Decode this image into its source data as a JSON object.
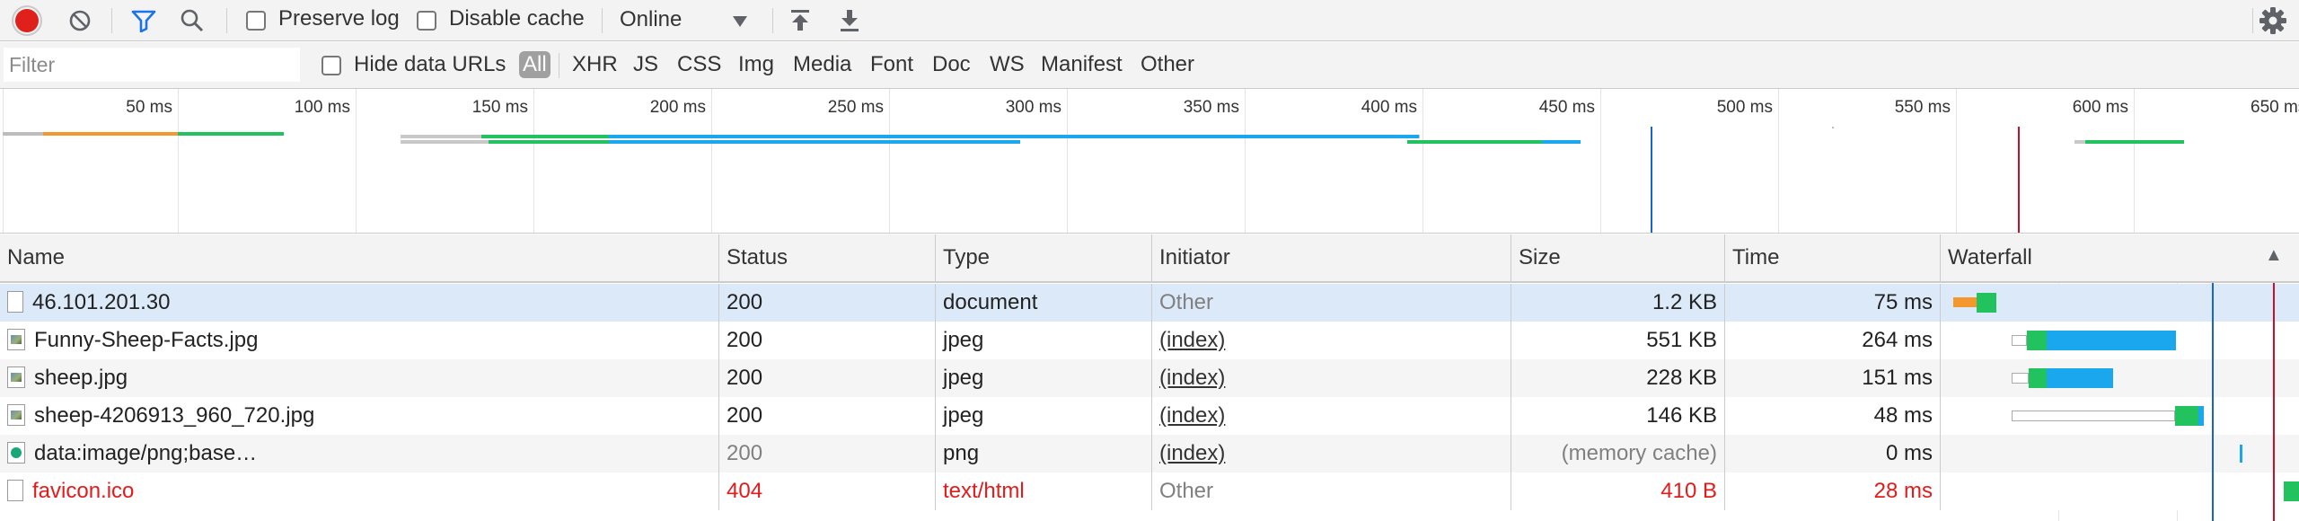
{
  "toolbar": {
    "record_icon": "record-icon",
    "clear_icon": "clear-icon",
    "filter_icon": "filter-icon",
    "search_icon": "search-icon",
    "preserve_log_label": "Preserve log",
    "disable_cache_label": "Disable cache",
    "throttling_value": "Online",
    "import_icon": "upload-icon",
    "export_icon": "download-icon",
    "settings_icon": "gear-icon"
  },
  "filterbar": {
    "filter_placeholder": "Filter",
    "hide_data_urls_label": "Hide data URLs",
    "types": [
      "All",
      "XHR",
      "JS",
      "CSS",
      "Img",
      "Media",
      "Font",
      "Doc",
      "WS",
      "Manifest",
      "Other"
    ],
    "active_type": "All"
  },
  "overview": {
    "ticks": [
      "50 ms",
      "100 ms",
      "150 ms",
      "200 ms",
      "250 ms",
      "300 ms",
      "350 ms",
      "400 ms",
      "450 ms",
      "500 ms",
      "550 ms",
      "600 ms",
      "650 ms"
    ]
  },
  "table": {
    "columns": [
      "Name",
      "Status",
      "Type",
      "Initiator",
      "Size",
      "Time",
      "Waterfall"
    ],
    "sort_indicator": "▲",
    "rows": [
      {
        "name": "46.101.201.30",
        "status": "200",
        "type": "document",
        "initiator": "Other",
        "size": "1.2 KB",
        "time": "75 ms",
        "icon": "document-icon"
      },
      {
        "name": "Funny-Sheep-Facts.jpg",
        "status": "200",
        "type": "jpeg",
        "initiator": "(index)",
        "size": "551 KB",
        "time": "264 ms",
        "icon": "image-icon"
      },
      {
        "name": "sheep.jpg",
        "status": "200",
        "type": "jpeg",
        "initiator": "(index)",
        "size": "228 KB",
        "time": "151 ms",
        "icon": "image-icon"
      },
      {
        "name": "sheep-4206913_960_720.jpg",
        "status": "200",
        "type": "jpeg",
        "initiator": "(index)",
        "size": "146 KB",
        "time": "48 ms",
        "icon": "image-icon"
      },
      {
        "name": "data:image/png;base…",
        "status": "200",
        "type": "png",
        "initiator": "(index)",
        "size": "(memory cache)",
        "time": "0 ms",
        "icon": "data-image-icon"
      },
      {
        "name": "favicon.ico",
        "status": "404",
        "type": "text/html",
        "initiator": "Other",
        "size": "410 B",
        "time": "28 ms",
        "icon": "document-icon"
      }
    ]
  },
  "colors": {
    "record": "#e0201b",
    "filter_active": "#1a73e8",
    "selected_row": "#dce9f8",
    "alt_row": "#f5f5f5",
    "error": "#e21b1b",
    "queue": "#f2982f",
    "waiting": "#22c35e",
    "download": "#1ba7ee",
    "dom_content_loaded": "#1a63c9",
    "load": "#c8102e"
  }
}
